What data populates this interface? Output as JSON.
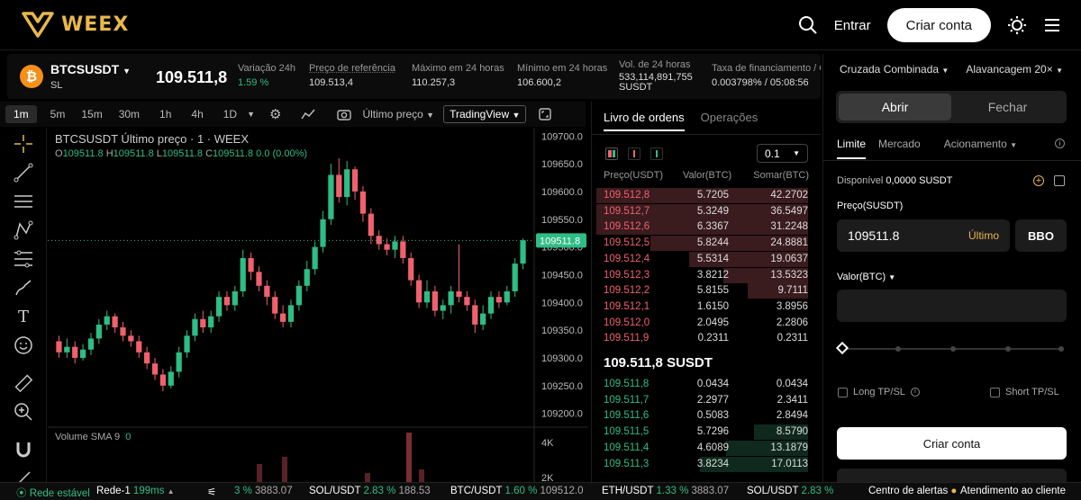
{
  "header": {
    "brand": "WEEX",
    "login_label": "Entrar",
    "signup_label": "Criar conta"
  },
  "ticker": {
    "symbol": "BTCSUSDT",
    "symbol_sub": "SL",
    "coin_glyph": "₿",
    "last_price": "109.511,8",
    "stats": [
      {
        "label": "Variação 24h",
        "value": "1.59 %",
        "green": true
      },
      {
        "label": "Preço de referência",
        "value": "109.513,4"
      },
      {
        "label": "Máximo em 24 horas",
        "value": "110.257,3"
      },
      {
        "label": "Mínimo em 24 horas",
        "value": "106.600,2"
      },
      {
        "label": "Vol. de 24 horas",
        "value": "533,114,891,755",
        "value2": "SUSDT"
      },
      {
        "label": "Taxa de financiamento / C",
        "value": "0.003798% / 05:08:56"
      }
    ]
  },
  "chart_toolbar": {
    "timeframes": [
      "1m",
      "5m",
      "15m",
      "30m",
      "1h",
      "4h",
      "1D"
    ],
    "price_type": "Último preço",
    "view": "TradingView"
  },
  "chart": {
    "title": "BTCSUSDT Último preço · 1 · WEEX",
    "ohlc": {
      "o": "109511.8",
      "h": "109511.8",
      "l": "109511.8",
      "c": "109511.8",
      "change": "0.0 (0.00%)"
    },
    "volume_label": "Volume SMA 9",
    "volume_value": "0",
    "price_tag": "109511.8",
    "volume_axis": [
      "4K",
      "2K"
    ]
  },
  "chart_data": {
    "type": "candlestick",
    "y_ticks": [
      109700,
      109650,
      109600,
      109550,
      109500,
      109450,
      109400,
      109350,
      109300,
      109250,
      109200
    ],
    "y_tick_labels": [
      "109700.0",
      "109650.0",
      "109600.0",
      "109550.0",
      "109500.0",
      "109450.0",
      "109400.0",
      "109350.0",
      "109300.0",
      "109250.0",
      "109200.0"
    ],
    "ylim": [
      109180,
      109715
    ],
    "last_price": 109511.8,
    "candles": [
      [
        109330,
        109310,
        109340,
        109300
      ],
      [
        109310,
        109320,
        109335,
        109300
      ],
      [
        109320,
        109300,
        109330,
        109290
      ],
      [
        109300,
        109315,
        109325,
        109295
      ],
      [
        109315,
        109335,
        109345,
        109305
      ],
      [
        109335,
        109360,
        109370,
        109325
      ],
      [
        109360,
        109375,
        109385,
        109350
      ],
      [
        109375,
        109355,
        109380,
        109345
      ],
      [
        109355,
        109340,
        109365,
        109330
      ],
      [
        109340,
        109330,
        109350,
        109320
      ],
      [
        109330,
        109310,
        109340,
        109300
      ],
      [
        109310,
        109290,
        109320,
        109280
      ],
      [
        109290,
        109270,
        109300,
        109260
      ],
      [
        109270,
        109250,
        109280,
        109240
      ],
      [
        109250,
        109275,
        109285,
        109245
      ],
      [
        109275,
        109310,
        109320,
        109265
      ],
      [
        109310,
        109340,
        109350,
        109300
      ],
      [
        109340,
        109370,
        109380,
        109330
      ],
      [
        109370,
        109355,
        109385,
        109345
      ],
      [
        109355,
        109375,
        109385,
        109345
      ],
      [
        109375,
        109410,
        109420,
        109365
      ],
      [
        109410,
        109395,
        109420,
        109385
      ],
      [
        109395,
        109420,
        109430,
        109385
      ],
      [
        109420,
        109480,
        109495,
        109410
      ],
      [
        109480,
        109455,
        109490,
        109440
      ],
      [
        109455,
        109430,
        109465,
        109420
      ],
      [
        109430,
        109410,
        109440,
        109395
      ],
      [
        109410,
        109380,
        109420,
        109370
      ],
      [
        109380,
        109365,
        109395,
        109355
      ],
      [
        109365,
        109395,
        109405,
        109355
      ],
      [
        109395,
        109430,
        109440,
        109385
      ],
      [
        109430,
        109460,
        109475,
        109420
      ],
      [
        109460,
        109500,
        109510,
        109450
      ],
      [
        109500,
        109550,
        109565,
        109490
      ],
      [
        109550,
        109630,
        109650,
        109540
      ],
      [
        109630,
        109590,
        109660,
        109580
      ],
      [
        109590,
        109640,
        109655,
        109575
      ],
      [
        109640,
        109600,
        109645,
        109585
      ],
      [
        109600,
        109560,
        109610,
        109545
      ],
      [
        109560,
        109520,
        109570,
        109505
      ],
      [
        109520,
        109505,
        109530,
        109495
      ],
      [
        109505,
        109495,
        109515,
        109485
      ],
      [
        109495,
        109510,
        109520,
        109480
      ],
      [
        109510,
        109480,
        109520,
        109470
      ],
      [
        109480,
        109440,
        109490,
        109430
      ],
      [
        109440,
        109400,
        109450,
        109390
      ],
      [
        109400,
        109420,
        109440,
        109390
      ],
      [
        109420,
        109385,
        109430,
        109375
      ],
      [
        109385,
        109395,
        109405,
        109370
      ],
      [
        109395,
        109420,
        109430,
        109380
      ],
      [
        109420,
        109410,
        109505,
        109400
      ],
      [
        109410,
        109395,
        109420,
        109385
      ],
      [
        109395,
        109360,
        109405,
        109345
      ],
      [
        109360,
        109380,
        109395,
        109350
      ],
      [
        109380,
        109410,
        109420,
        109370
      ],
      [
        109410,
        109400,
        109420,
        109390
      ],
      [
        109400,
        109420,
        109430,
        109395
      ],
      [
        109420,
        109470,
        109480,
        109410
      ],
      [
        109470,
        109512,
        109515,
        109460
      ]
    ]
  },
  "orderbook": {
    "tabs": [
      "Livro de ordens",
      "Operações"
    ],
    "precision": "0.1",
    "headers": [
      "Preço(USDT)",
      "Valor(BTC)",
      "Somar(BTC)"
    ],
    "asks": [
      {
        "price": "109.512,8",
        "amount": "5.7205",
        "sum": "42.2702",
        "depth": 0.98
      },
      {
        "price": "109.512,7",
        "amount": "5.3249",
        "sum": "36.5497",
        "depth": 0.98
      },
      {
        "price": "109.512,6",
        "amount": "6.3367",
        "sum": "31.2248",
        "depth": 0.98
      },
      {
        "price": "109.512,5",
        "amount": "5.8244",
        "sum": "24.8881",
        "depth": 0.73
      },
      {
        "price": "109.512,4",
        "amount": "5.5314",
        "sum": "19.0637",
        "depth": 0.55
      },
      {
        "price": "109.512,3",
        "amount": "3.8212",
        "sum": "13.5323",
        "depth": 0.39
      },
      {
        "price": "109.512,2",
        "amount": "5.8155",
        "sum": "9.7111",
        "depth": 0.28
      },
      {
        "price": "109.512,1",
        "amount": "1.6150",
        "sum": "3.8956",
        "depth": 0
      },
      {
        "price": "109.512,0",
        "amount": "2.0495",
        "sum": "2.2806",
        "depth": 0
      },
      {
        "price": "109.511,9",
        "amount": "0.2311",
        "sum": "0.2311",
        "depth": 0
      }
    ],
    "mid_price": "109.511,8 SUSDT",
    "bids": [
      {
        "price": "109.511,8",
        "amount": "0.0434",
        "sum": "0.0434",
        "depth": 0
      },
      {
        "price": "109.511,7",
        "amount": "2.2977",
        "sum": "2.3411",
        "depth": 0
      },
      {
        "price": "109.511,6",
        "amount": "0.5083",
        "sum": "2.8494",
        "depth": 0
      },
      {
        "price": "109.511,5",
        "amount": "5.7296",
        "sum": "8.5790",
        "depth": 0.25
      },
      {
        "price": "109.511,4",
        "amount": "4.6089",
        "sum": "13.1879",
        "depth": 0.38
      },
      {
        "price": "109.511,3",
        "amount": "3.8234",
        "sum": "17.0113",
        "depth": 0.5
      }
    ]
  },
  "order_panel": {
    "margin_mode": "Cruzada Combinada",
    "leverage": "Alavancagem 20×",
    "open_label": "Abrir",
    "close_label": "Fechar",
    "order_types": [
      "Limite",
      "Mercado",
      "Acionamento"
    ],
    "available_label": "Disponível",
    "available_value": "0,0000 SUSDT",
    "price_label": "Preço(SUSDT)",
    "price_value": "109511.8",
    "price_tag": "Último",
    "bbo": "BBO",
    "amount_label": "Valor(BTC)",
    "long_tpsl": "Long TP/SL",
    "short_tpsl": "Short TP/SL",
    "submit_label": "Criar conta"
  },
  "bottom_bar": {
    "network_status": "Rede estável",
    "node": "Rede-1",
    "latency": "199ms",
    "pairs": [
      {
        "pct": "3 %",
        "price": "3883.07",
        "symbol": ""
      },
      {
        "symbol": "SOL/USDT",
        "pct": "2.83 %",
        "price": "188.53"
      },
      {
        "symbol": "BTC/USDT",
        "pct": "1.60 %",
        "price": "109512.0"
      },
      {
        "symbol": "ETH/USDT",
        "pct": "1.33 %",
        "price": "3883.07"
      },
      {
        "symbol": "SOL/USDT",
        "pct": "2.83 %",
        "price": ""
      }
    ],
    "alerts": "Centro de alertas",
    "support": "Atendimento ao cliente"
  }
}
